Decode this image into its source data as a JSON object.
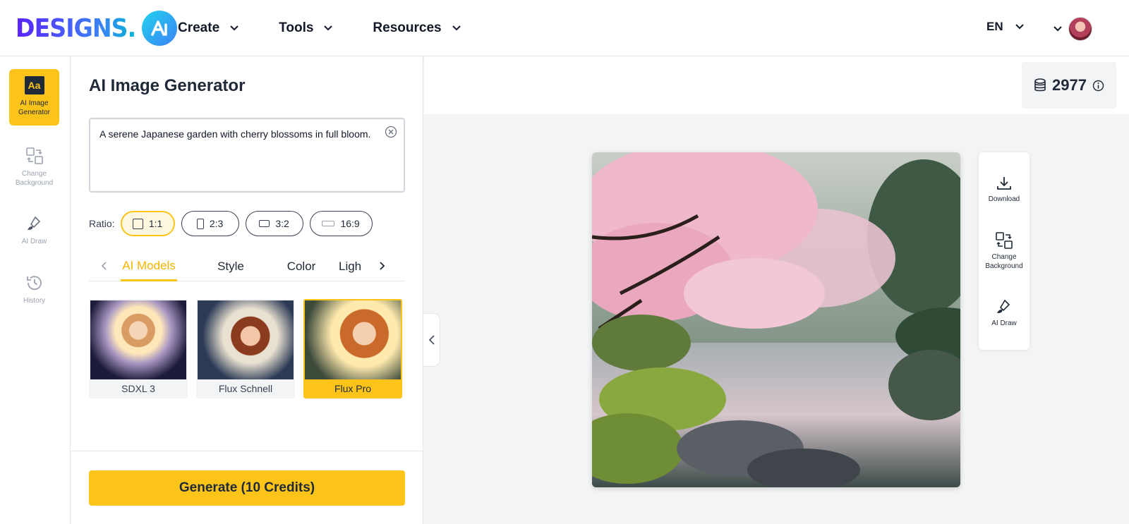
{
  "header": {
    "logo_text": "DESIGNS.",
    "nav": [
      {
        "label": "Create"
      },
      {
        "label": "Tools"
      },
      {
        "label": "Resources"
      }
    ],
    "language": "EN"
  },
  "sidebar": {
    "items": [
      {
        "label": "AI Image Generator",
        "icon": "aa-icon",
        "active": true
      },
      {
        "label": "Change Background",
        "icon": "swap-icon"
      },
      {
        "label": "AI Draw",
        "icon": "brush-icon"
      },
      {
        "label": "History",
        "icon": "history-icon"
      }
    ],
    "aa_glyph": "Aa"
  },
  "panel": {
    "title": "AI Image Generator",
    "prompt_value": "A serene Japanese garden with cherry blossoms in full bloom.",
    "ratio_label": "Ratio:",
    "ratios": [
      {
        "label": "1:1",
        "active": true
      },
      {
        "label": "2:3"
      },
      {
        "label": "3:2"
      },
      {
        "label": "16:9"
      }
    ],
    "tabs": [
      {
        "label": "AI Models",
        "active": true
      },
      {
        "label": "Style"
      },
      {
        "label": "Color"
      },
      {
        "label": "Ligh"
      }
    ],
    "models": [
      {
        "name": "SDXL 3"
      },
      {
        "name": "Flux Schnell"
      },
      {
        "name": "Flux Pro",
        "selected": true
      }
    ],
    "generate_label": "Generate (10 Credits)"
  },
  "credits": {
    "value": "2977"
  },
  "actions": [
    {
      "label": "Download"
    },
    {
      "label": "Change Background"
    },
    {
      "label": "AI Draw"
    }
  ],
  "colors": {
    "accent": "#fcc419",
    "active_tab_text": "#f4b400"
  }
}
